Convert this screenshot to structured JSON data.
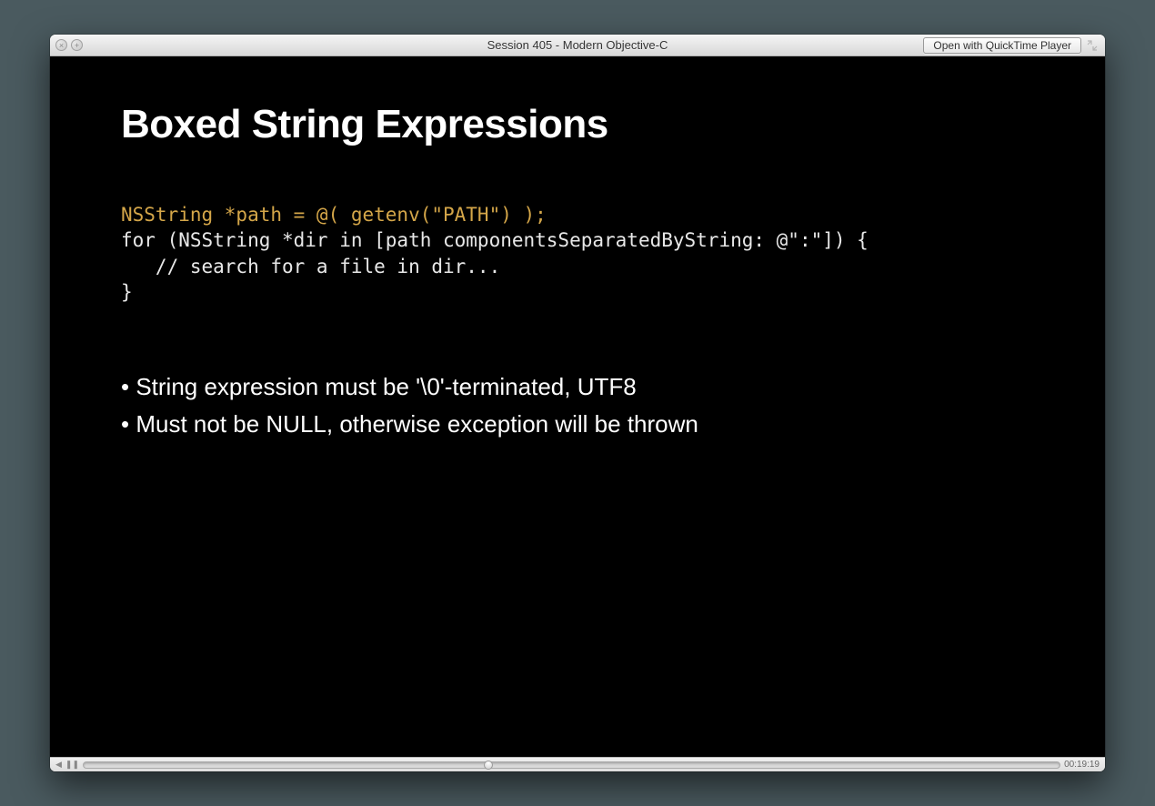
{
  "window": {
    "title": "Session 405 - Modern Objective-C",
    "open_button_label": "Open with QuickTime Player"
  },
  "slide": {
    "title": "Boxed String Expressions",
    "code": {
      "line1_highlight": "NSString *path = @( getenv(\"PATH\") );",
      "line2": "for (NSString *dir in [path componentsSeparatedByString: @\":\"]) {",
      "line3": "   // search for a file in dir...",
      "line4": "}"
    },
    "bullets": [
      "String expression must be '\\0'-terminated, UTF8",
      "Must not be NULL, otherwise exception will be thrown"
    ]
  },
  "playback": {
    "time": "00:19:19"
  }
}
